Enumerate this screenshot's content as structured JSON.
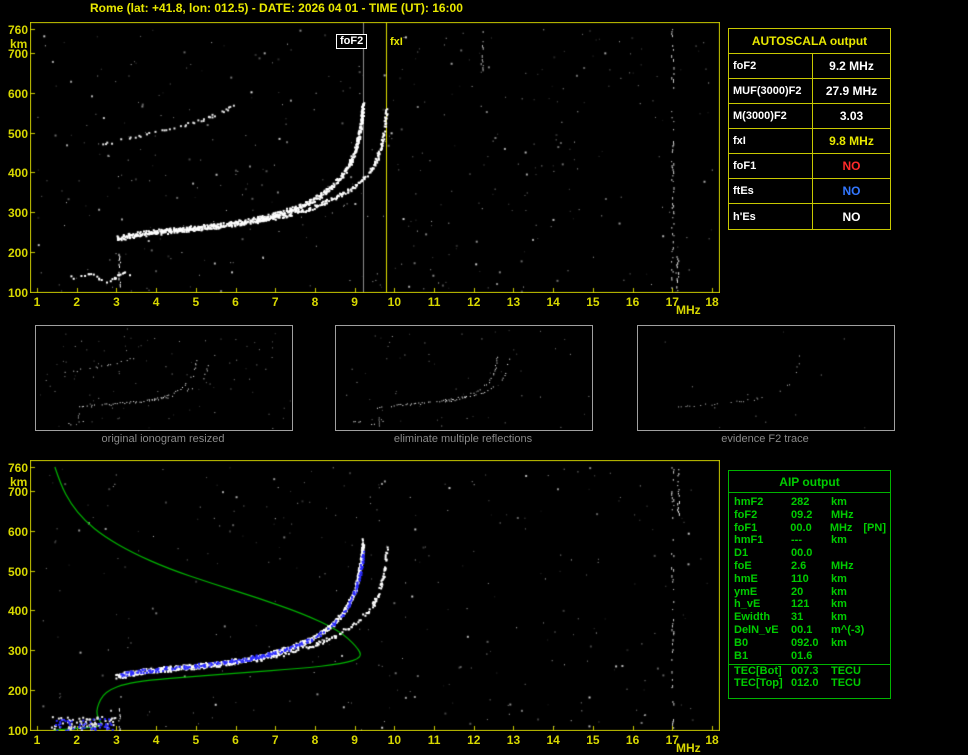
{
  "title": "Rome (lat: +41.8, lon: 012.5) - DATE: 2026 04 01 - TIME (UT): 16:00",
  "colors": {
    "background": "#000000",
    "axis_yellow": "#d8d800",
    "table_border_yellow": "#c8c800",
    "aip_green": "#00cc00",
    "trace_white": "#ffffff",
    "autoscala_trace_blue": "#2a2aff",
    "profile_green": "#00b400",
    "caption_gray": "#8a8a8a",
    "no_red": "#ff2a2a",
    "no_blue": "#3377ff"
  },
  "autoscala_table": {
    "title": "AUTOSCALA output",
    "rows": [
      {
        "param": "foF2",
        "value": "9.2 MHz",
        "color": "#ffffff"
      },
      {
        "param": "MUF(3000)F2",
        "value": "27.9 MHz",
        "color": "#ffffff"
      },
      {
        "param": "M(3000)F2",
        "value": "3.03",
        "color": "#ffffff"
      },
      {
        "param": "fxI",
        "value": "9.8 MHz",
        "color": "#e8e800"
      },
      {
        "param": "foF1",
        "value": "NO",
        "color": "#ff2a2a"
      },
      {
        "param": "ftEs",
        "value": "NO",
        "color": "#3377ff"
      },
      {
        "param": "h'Es",
        "value": "NO",
        "color": "#ffffff"
      }
    ]
  },
  "aip_table": {
    "title": "AIP output",
    "rows": [
      {
        "param": "hmF2",
        "value": "282",
        "unit": "km",
        "note": ""
      },
      {
        "param": "foF2",
        "value": "09.2",
        "unit": "MHz",
        "note": ""
      },
      {
        "param": "foF1",
        "value": "00.0",
        "unit": "MHz",
        "note": "[PN]"
      },
      {
        "param": "hmF1",
        "value": "---",
        "unit": "km",
        "note": ""
      },
      {
        "param": "D1",
        "value": "00.0",
        "unit": "",
        "note": ""
      },
      {
        "param": "foE",
        "value": "2.6",
        "unit": "MHz",
        "note": ""
      },
      {
        "param": "hmE",
        "value": "110",
        "unit": "km",
        "note": ""
      },
      {
        "param": "ymE",
        "value": "20",
        "unit": "km",
        "note": ""
      },
      {
        "param": "h_vE",
        "value": "121",
        "unit": "km",
        "note": ""
      },
      {
        "param": "Ewidth",
        "value": "31",
        "unit": "km",
        "note": ""
      },
      {
        "param": "DelN_vE",
        "value": "00.1",
        "unit": "m^(-3)",
        "note": ""
      },
      {
        "param": "B0",
        "value": "092.0",
        "unit": "km",
        "note": ""
      },
      {
        "param": "B1",
        "value": "01.6",
        "unit": "",
        "note": ""
      },
      {
        "param": "TEC[Bot]",
        "value": "007.3",
        "unit": "TECU",
        "note": "",
        "separator_above": true
      },
      {
        "param": "TEC[Top]",
        "value": "012.0",
        "unit": "TECU",
        "note": ""
      }
    ]
  },
  "thumbnails": [
    {
      "caption": "original ionogram resized"
    },
    {
      "caption": "eliminate multiple reflections"
    },
    {
      "caption": "evidence F2 trace"
    }
  ],
  "chart_data": [
    {
      "id": "top_ionogram",
      "type": "scatter",
      "title": "ionogram Rome 2026-04-01 16:00 UT",
      "xlabel": "MHz",
      "ylabel": "km",
      "xlim": [
        1,
        18
      ],
      "ylim": [
        100,
        760
      ],
      "x_ticks": [
        1,
        2,
        3,
        4,
        5,
        6,
        7,
        8,
        9,
        10,
        11,
        12,
        13,
        14,
        15,
        16,
        17,
        18
      ],
      "y_ticks": [
        100,
        200,
        300,
        400,
        500,
        600,
        700,
        760
      ],
      "grid": false,
      "annotations": [
        {
          "label": "foF2",
          "x": 9.2,
          "color": "#ffffff",
          "boxed": true
        },
        {
          "label": "fxI",
          "x": 9.8,
          "color": "#e8e800",
          "boxed": false
        }
      ],
      "vlines": [
        {
          "x": 9.2,
          "color": "rgba(255,255,255,0.55)"
        },
        {
          "x": 9.8,
          "color": "#e0e000"
        }
      ],
      "traces": [
        {
          "name": "F2-ordinary-trace",
          "color": "#ffffff",
          "size": 2,
          "density": 0.8,
          "passes": 3,
          "points": [
            [
              3.0,
              236
            ],
            [
              3.3,
              243
            ],
            [
              3.8,
              250
            ],
            [
              4.4,
              256
            ],
            [
              5.0,
              262
            ],
            [
              5.6,
              268
            ],
            [
              6.2,
              277
            ],
            [
              6.8,
              290
            ],
            [
              7.4,
              308
            ],
            [
              7.9,
              330
            ],
            [
              8.3,
              356
            ],
            [
              8.6,
              385
            ],
            [
              8.85,
              420
            ],
            [
              9.0,
              455
            ],
            [
              9.1,
              495
            ],
            [
              9.17,
              540
            ],
            [
              9.2,
              575
            ]
          ]
        },
        {
          "name": "F2-extraordinary-trace",
          "color": "#ffffff",
          "size": 2,
          "density": 0.55,
          "passes": 2,
          "points": [
            [
              6.5,
              278
            ],
            [
              7.2,
              292
            ],
            [
              7.9,
              312
            ],
            [
              8.5,
              338
            ],
            [
              9.0,
              368
            ],
            [
              9.35,
              400
            ],
            [
              9.55,
              435
            ],
            [
              9.68,
              475
            ],
            [
              9.75,
              520
            ],
            [
              9.79,
              560
            ]
          ]
        },
        {
          "name": "multiple-reflection-trace",
          "color": "#e0e0e0",
          "size": 2,
          "density": 0.3,
          "passes": 1,
          "points": [
            [
              2.4,
              468
            ],
            [
              2.8,
              476
            ],
            [
              3.2,
              486
            ],
            [
              3.7,
              497
            ],
            [
              4.2,
              508
            ],
            [
              4.7,
              521
            ],
            [
              5.2,
              536
            ],
            [
              5.7,
              556
            ],
            [
              6.1,
              580
            ],
            [
              6.4,
              608
            ]
          ]
        },
        {
          "name": "es-fragment",
          "color": "#ffffff",
          "size": 2,
          "density": 0.45,
          "passes": 1,
          "points": [
            [
              1.75,
              148
            ],
            [
              1.95,
              137
            ],
            [
              2.15,
              143
            ],
            [
              2.4,
              149
            ],
            [
              2.6,
              132
            ],
            [
              2.75,
              127
            ],
            [
              3.0,
              141
            ],
            [
              3.2,
              152
            ],
            [
              3.35,
              146
            ]
          ]
        }
      ],
      "vstreaks": [
        {
          "x": 3.08,
          "h0": 112,
          "h1": 196,
          "color": "#ffffff",
          "density": 0.65
        },
        {
          "x": 17.0,
          "h0": 100,
          "h1": 760,
          "color": "#c8c8c8",
          "density": 0.35
        },
        {
          "x": 12.2,
          "h0": 650,
          "h1": 755,
          "color": "#b0b0b0",
          "density": 0.4
        },
        {
          "x": 17.12,
          "h0": 100,
          "h1": 190,
          "color": "#e8e8e8",
          "density": 0.7
        }
      ],
      "noise": {
        "count": 400,
        "seed": 7
      }
    },
    {
      "id": "bottom_ionogram",
      "type": "scatter",
      "title": "autoscaled ionogram with restored electron density profile",
      "xlabel": "MHz",
      "ylabel": "km",
      "xlim": [
        1,
        18
      ],
      "ylim": [
        100,
        760
      ],
      "x_ticks": [
        1,
        2,
        3,
        4,
        5,
        6,
        7,
        8,
        9,
        10,
        11,
        12,
        13,
        14,
        15,
        16,
        17,
        18
      ],
      "y_ticks": [
        100,
        200,
        300,
        400,
        500,
        600,
        700,
        760
      ],
      "grid": false,
      "annotations": [],
      "vlines": [],
      "profile": {
        "name": "electron-density-profile",
        "color": "#00b400",
        "points": [
          [
            1.45,
            760
          ],
          [
            1.6,
            715
          ],
          [
            1.85,
            668
          ],
          [
            2.2,
            625
          ],
          [
            2.7,
            585
          ],
          [
            3.4,
            545
          ],
          [
            4.3,
            505
          ],
          [
            5.4,
            468
          ],
          [
            6.6,
            430
          ],
          [
            7.7,
            392
          ],
          [
            8.6,
            350
          ],
          [
            9.05,
            310
          ],
          [
            9.2,
            282
          ],
          [
            8.7,
            266
          ],
          [
            7.6,
            254
          ],
          [
            6.2,
            244
          ],
          [
            4.9,
            234
          ],
          [
            3.8,
            225
          ],
          [
            3.2,
            215
          ],
          [
            2.85,
            202
          ],
          [
            2.65,
            186
          ],
          [
            2.55,
            166
          ],
          [
            2.5,
            148
          ],
          [
            2.53,
            132
          ],
          [
            2.6,
            120
          ],
          [
            2.63,
            112
          ],
          [
            2.4,
            107
          ],
          [
            2.0,
            104
          ],
          [
            1.6,
            101
          ],
          [
            1.42,
            100
          ]
        ]
      },
      "traces": [
        {
          "name": "F2-ordinary-trace",
          "color": "#ffffff",
          "size": 2,
          "density": 0.8,
          "passes": 3,
          "points": [
            [
              3.0,
              236
            ],
            [
              3.3,
              243
            ],
            [
              3.8,
              250
            ],
            [
              4.4,
              256
            ],
            [
              5.0,
              262
            ],
            [
              5.6,
              268
            ],
            [
              6.2,
              277
            ],
            [
              6.8,
              290
            ],
            [
              7.4,
              308
            ],
            [
              7.9,
              330
            ],
            [
              8.3,
              356
            ],
            [
              8.6,
              385
            ],
            [
              8.85,
              420
            ],
            [
              9.0,
              455
            ],
            [
              9.1,
              495
            ],
            [
              9.17,
              540
            ],
            [
              9.2,
              575
            ]
          ]
        },
        {
          "name": "F2-extraordinary-trace",
          "color": "#ffffff",
          "size": 2,
          "density": 0.4,
          "passes": 2,
          "points": [
            [
              6.5,
              278
            ],
            [
              7.2,
              292
            ],
            [
              7.9,
              312
            ],
            [
              8.5,
              338
            ],
            [
              9.0,
              368
            ],
            [
              9.35,
              400
            ],
            [
              9.55,
              435
            ],
            [
              9.68,
              475
            ],
            [
              9.75,
              520
            ],
            [
              9.79,
              560
            ]
          ]
        },
        {
          "name": "autoscala-identified-trace",
          "color": "#2a2aff",
          "size": 2,
          "density": 0.5,
          "passes": 2,
          "points": [
            [
              3.05,
              240
            ],
            [
              3.5,
              248
            ],
            [
              4.1,
              254
            ],
            [
              4.8,
              261
            ],
            [
              5.5,
              268
            ],
            [
              6.2,
              278
            ],
            [
              6.9,
              293
            ],
            [
              7.5,
              312
            ],
            [
              8.0,
              334
            ],
            [
              8.4,
              362
            ],
            [
              8.7,
              392
            ],
            [
              8.9,
              428
            ],
            [
              9.05,
              465
            ],
            [
              9.15,
              505
            ],
            [
              9.2,
              550
            ]
          ]
        }
      ],
      "clusters": [
        {
          "name": "e-region-echoes",
          "color": "#e8e8e8",
          "count": 80,
          "f0": 1.35,
          "f1": 2.95,
          "h0": 100,
          "h1": 136
        },
        {
          "name": "e-region-echoes-blue",
          "color": "#2a2aff",
          "count": 50,
          "f0": 1.4,
          "f1": 2.9,
          "h0": 100,
          "h1": 130
        }
      ],
      "vstreaks": [
        {
          "x": 3.08,
          "h0": 104,
          "h1": 200,
          "color": "#ffffff",
          "density": 0.6
        },
        {
          "x": 17.0,
          "h0": 100,
          "h1": 760,
          "color": "#c8c8c8",
          "density": 0.3
        },
        {
          "x": 17.15,
          "h0": 640,
          "h1": 760,
          "color": "#e8e8e8",
          "density": 0.6
        }
      ],
      "noise": {
        "count": 300,
        "seed": 13
      }
    }
  ]
}
